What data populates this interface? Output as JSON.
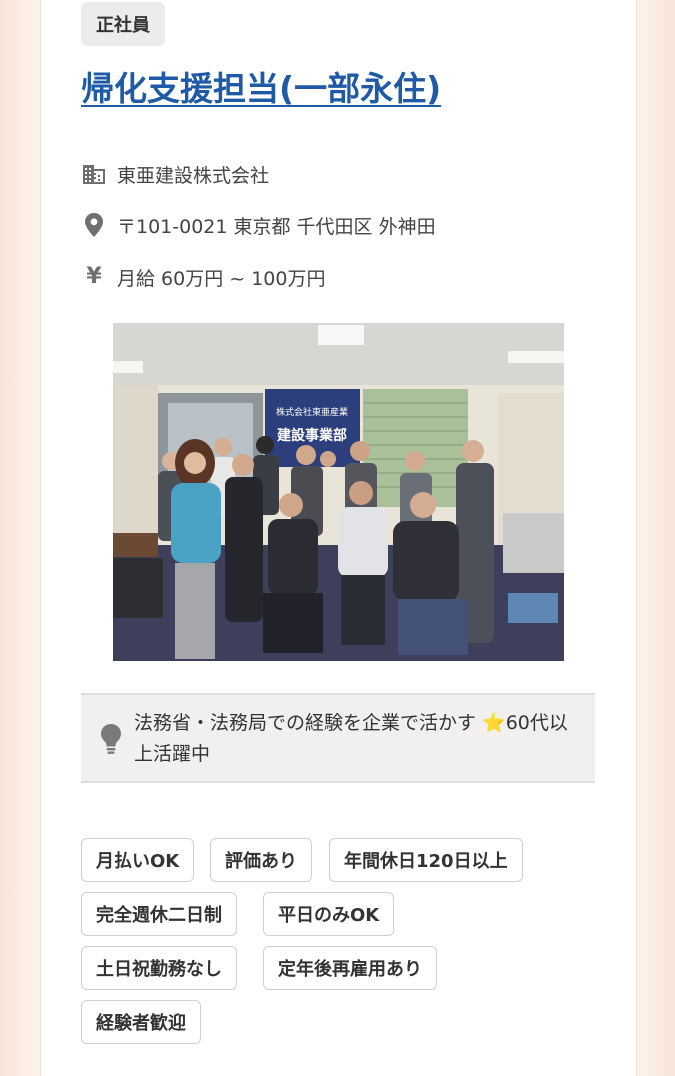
{
  "employment_type": "正社員",
  "job": {
    "title": "帰化支援担当(一部永住)",
    "company": "東亜建設株式会社",
    "address": "〒101-0021 東京都 千代田区 外神田",
    "salary": "月給 60万円 ~ 100万円"
  },
  "icons": {
    "company": "building-icon",
    "address": "map-pin-icon",
    "salary": "yen-icon",
    "highlight": "lightbulb-icon"
  },
  "photo": {
    "banner_line1": "株式会社東亜産業",
    "banner_line2": "建設事業部"
  },
  "highlight": {
    "text": "法務省・法務局での経験を企業で活かす ⭐60代以上活躍中"
  },
  "tags": [
    "月払いOK",
    "評価あり",
    "年間休日120日以上",
    "完全週休二日制",
    "平日のみOK",
    "土日祝勤務なし",
    "定年後再雇用あり",
    "経験者歓迎"
  ],
  "colors": {
    "title_link": "#1f5aa6",
    "icon_gray": "#6f6f6f",
    "page_bg": "#fbeee6"
  }
}
